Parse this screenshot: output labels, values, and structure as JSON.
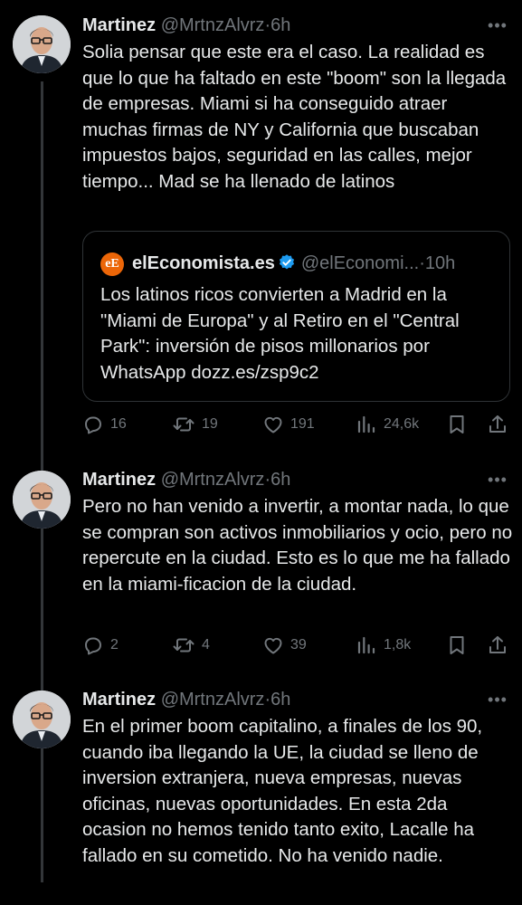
{
  "thread": [
    {
      "author": {
        "name": "Martinez",
        "handle": "@MrtnzAlvrz",
        "time": "6h"
      },
      "text": "Solia pensar que este era el caso. La realidad es que lo que ha faltado en este \"boom\" son la llegada de empresas. Miami si ha conseguido atraer muchas firmas de NY y California que buscaban  impuestos bajos, seguridad en las calles, mejor tiempo... Mad se ha llenado de latinos",
      "quote": {
        "logo_text": "eE",
        "name": "elEconomista.es",
        "handle": "@elEconomi...",
        "time": "10h",
        "text": "Los latinos ricos convierten a Madrid en la \"Miami de Europa\" y al Retiro en el \"Central Park\": inversión de pisos millonarios por WhatsApp dozz.es/zsp9c2"
      },
      "stats": {
        "replies": "16",
        "reposts": "19",
        "likes": "191",
        "views": "24,6k"
      }
    },
    {
      "author": {
        "name": "Martinez",
        "handle": "@MrtnzAlvrz",
        "time": "6h"
      },
      "text": "Pero no han venido a invertir, a montar nada, lo que se compran son activos inmobiliarios y ocio, pero no repercute en la ciudad. Esto es lo que me ha fallado en la miami-ficacion de la ciudad.",
      "stats": {
        "replies": "2",
        "reposts": "4",
        "likes": "39",
        "views": "1,8k"
      }
    },
    {
      "author": {
        "name": "Martinez",
        "handle": "@MrtnzAlvrz",
        "time": "6h"
      },
      "text": "En el primer boom capitalino, a finales de los 90, cuando iba llegando la UE, la ciudad se lleno de inversion extranjera, nueva empresas, nuevas oficinas, nuevas oportunidades. En esta 2da ocasion no hemos tenido tanto exito, Lacalle ha fallado en su cometido. No ha venido nadie."
    }
  ],
  "ui": {
    "separator": "·",
    "more_glyph": "•••"
  },
  "colors": {
    "background": "#000000",
    "text": "#e7e9ea",
    "muted": "#71767b",
    "border": "#2f3336",
    "verified": "#1d9bf0",
    "logo": "#ec6608"
  },
  "icons": [
    "reply-icon",
    "repost-icon",
    "like-icon",
    "views-icon",
    "bookmark-icon",
    "share-icon",
    "verified-badge-icon",
    "more-icon"
  ]
}
